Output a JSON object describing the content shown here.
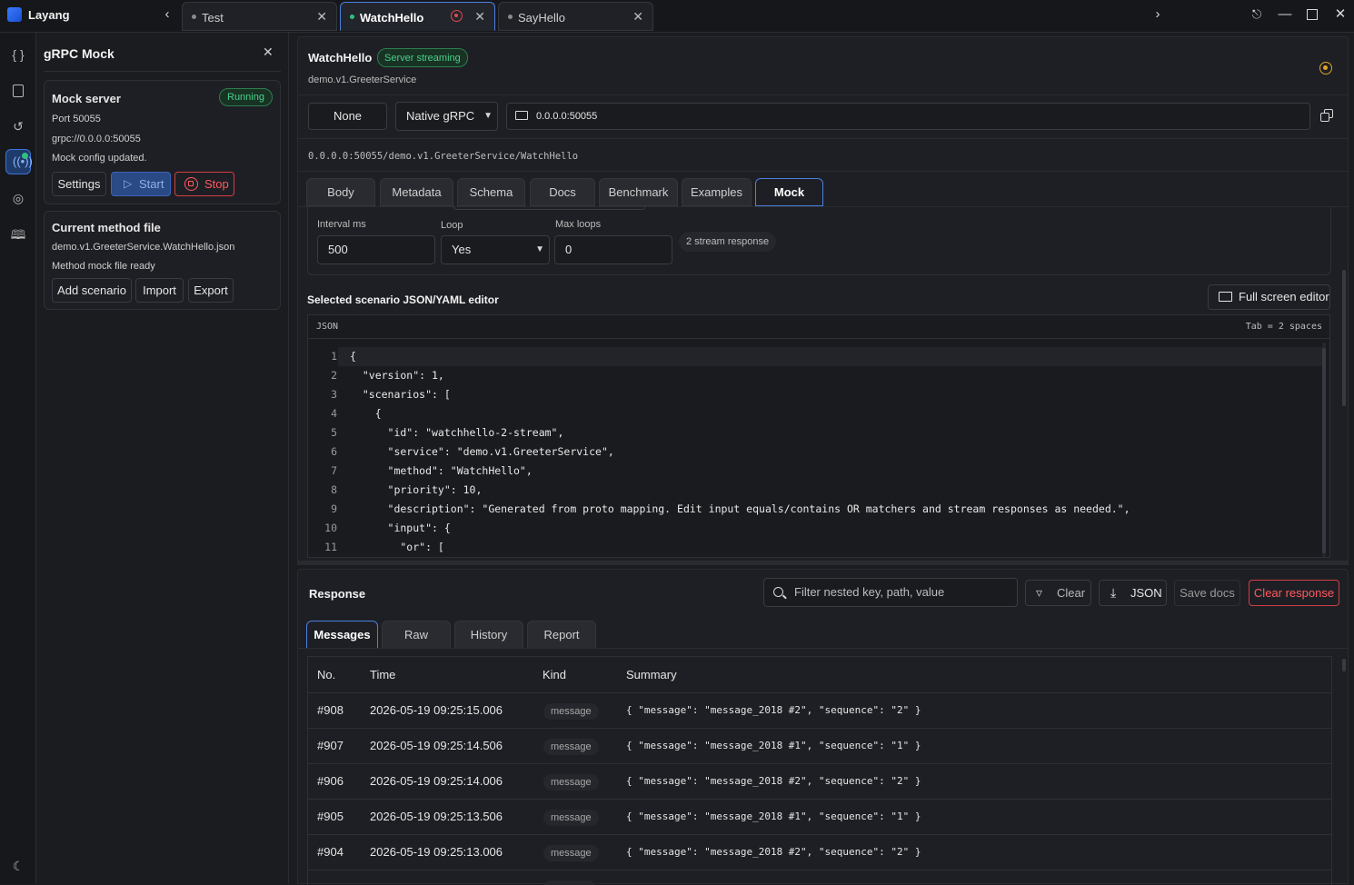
{
  "app": {
    "name": "Layang"
  },
  "tabs": [
    {
      "label": "Test"
    },
    {
      "label": "WatchHello"
    },
    {
      "label": "SayHello"
    }
  ],
  "side": {
    "title": "gRPC Mock",
    "mock_server": {
      "title": "Mock server",
      "status": "Running",
      "port": "Port 50055",
      "url": "grpc://0.0.0.0:50055",
      "message": "Mock config updated.",
      "settings_label": "Settings",
      "start_label": "Start",
      "stop_label": "Stop"
    },
    "method_file": {
      "title": "Current method file",
      "filename": "demo.v1.GreeterService.WatchHello.json",
      "status": "Method mock file ready",
      "add_label": "Add scenario",
      "import_label": "Import",
      "export_label": "Export"
    }
  },
  "request": {
    "method": "WatchHello",
    "badge": "Server streaming",
    "service": "demo.v1.GreeterService",
    "auth": "None",
    "protocol": "Native gRPC",
    "address": "0.0.0.0:50055",
    "path": "0.0.0.0:50055/demo.v1.GreeterService/WatchHello",
    "tabs": [
      "Body",
      "Metadata",
      "Schema",
      "Docs",
      "Benchmark",
      "Examples",
      "Mock"
    ]
  },
  "mock": {
    "interval_label": "Interval ms",
    "interval_value": "500",
    "loop_label": "Loop",
    "loop_value": "Yes",
    "maxloops_label": "Max loops",
    "maxloops_value": "0",
    "stream_hint": "2 stream response",
    "editor_title": "Selected scenario JSON/YAML editor",
    "fullscreen_label": "Full screen editor",
    "lang": "JSON",
    "tab_info": "Tab = 2 spaces",
    "lines": [
      {
        "n": "1",
        "t": "{"
      },
      {
        "n": "2",
        "t": "  \"version\": 1,"
      },
      {
        "n": "3",
        "t": "  \"scenarios\": ["
      },
      {
        "n": "4",
        "t": "    {"
      },
      {
        "n": "5",
        "t": "      \"id\": \"watchhello-2-stream\","
      },
      {
        "n": "6",
        "t": "      \"service\": \"demo.v1.GreeterService\","
      },
      {
        "n": "7",
        "t": "      \"method\": \"WatchHello\","
      },
      {
        "n": "8",
        "t": "      \"priority\": 10,"
      },
      {
        "n": "9",
        "t": "      \"description\": \"Generated from proto mapping. Edit input equals/contains OR matchers and stream responses as needed.\","
      },
      {
        "n": "10",
        "t": "      \"input\": {"
      },
      {
        "n": "11",
        "t": "        \"or\": ["
      }
    ]
  },
  "response": {
    "title": "Response",
    "filter_placeholder": "Filter nested key, path, value",
    "clear_label": "Clear",
    "json_label": "JSON",
    "save_docs_label": "Save docs",
    "clear_response_label": "Clear response",
    "tabs": [
      "Messages",
      "Raw",
      "History",
      "Report"
    ],
    "columns": [
      "No.",
      "Time",
      "Kind",
      "Summary"
    ],
    "rows": [
      {
        "no": "#908",
        "time": "2026-05-19 09:25:15.006",
        "kind": "message",
        "summary": "{ \"message\": \"message_2018 #2\", \"sequence\": \"2\" }"
      },
      {
        "no": "#907",
        "time": "2026-05-19 09:25:14.506",
        "kind": "message",
        "summary": "{ \"message\": \"message_2018 #1\", \"sequence\": \"1\" }"
      },
      {
        "no": "#906",
        "time": "2026-05-19 09:25:14.006",
        "kind": "message",
        "summary": "{ \"message\": \"message_2018 #2\", \"sequence\": \"2\" }"
      },
      {
        "no": "#905",
        "time": "2026-05-19 09:25:13.506",
        "kind": "message",
        "summary": "{ \"message\": \"message_2018 #1\", \"sequence\": \"1\" }"
      },
      {
        "no": "#904",
        "time": "2026-05-19 09:25:13.006",
        "kind": "message",
        "summary": "{ \"message\": \"message_2018 #2\", \"sequence\": \"2\" }"
      }
    ]
  },
  "colors": {
    "accent": "#3b74d6",
    "running": "#2ec27e",
    "danger": "#e5484d",
    "warning": "#e0a526"
  }
}
